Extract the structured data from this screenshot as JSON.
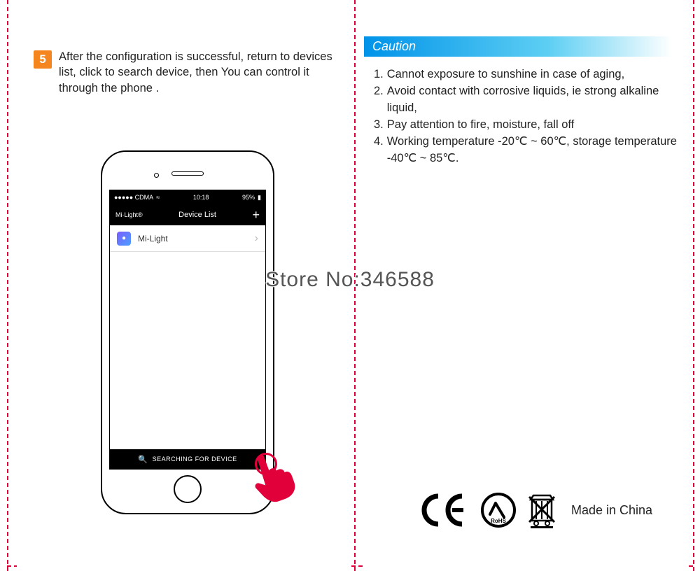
{
  "left": {
    "step_number": "5",
    "step_text": "After the configuration is successful, return to devices list, click to search device, then You can control it through the phone .",
    "phone": {
      "status_carrier": "●●●●● CDMA",
      "status_wifi": "≈",
      "status_time": "10:18",
      "status_battery_pct": "95%",
      "nav_brand": "Mi·Light®",
      "nav_title": "Device List",
      "nav_plus": "+",
      "row_app": "Mi-Light",
      "row_chev": "›",
      "search_label": "SEARCHING FOR DEVICE"
    }
  },
  "right": {
    "caution_heading": "Caution",
    "items": [
      {
        "n": "1.",
        "t": "Cannot exposure to sunshine in case of aging,"
      },
      {
        "n": "2.",
        "t": "Avoid contact with corrosive liquids, ie strong alkaline liquid,"
      },
      {
        "n": "3.",
        "t": "Pay attention to fire, moisture, fall off"
      },
      {
        "n": "4.",
        "t": "Working temperature -20℃ ~ 60℃, storage temperature -40℃ ~ 85℃."
      }
    ],
    "made_in": "Made in China"
  },
  "watermark": "Store No:346588"
}
